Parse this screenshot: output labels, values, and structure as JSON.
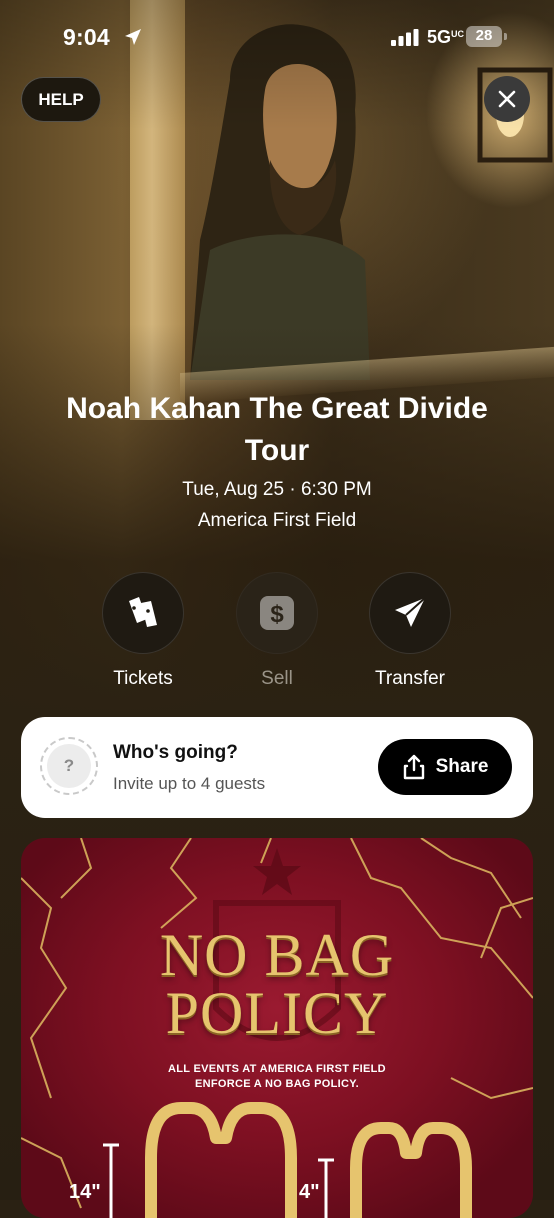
{
  "status_bar": {
    "time": "9:04",
    "network": "5G",
    "network_suffix": "UC",
    "battery_level": "28"
  },
  "header": {
    "help_label": "HELP",
    "close_icon": "close-icon"
  },
  "event": {
    "title": "Noah Kahan The Great Divide Tour",
    "date_time": "Tue, Aug 25 · 6:30 PM",
    "venue": "America First Field"
  },
  "actions": [
    {
      "label": "Tickets",
      "icon": "tickets-icon",
      "enabled": true
    },
    {
      "label": "Sell",
      "icon": "dollar-icon",
      "enabled": false
    },
    {
      "label": "Transfer",
      "icon": "paper-plane-icon",
      "enabled": true
    }
  ],
  "guests": {
    "heading": "Who's going?",
    "subtext": "Invite up to 4 guests",
    "avatar_placeholder": "?",
    "share_label": "Share"
  },
  "policy_banner": {
    "line1": "NO BAG",
    "line2": "POLICY",
    "fine_print_1": "ALL EVENTS AT AMERICA FIRST FIELD",
    "fine_print_2": "ENFORCE A NO BAG POLICY.",
    "dim_left": "14\"",
    "dim_right": "4\""
  },
  "colors": {
    "accent_gold": "#e6c46e",
    "banner_red": "#7e1022",
    "card_bg": "#ffffff",
    "share_bg": "#000000"
  }
}
